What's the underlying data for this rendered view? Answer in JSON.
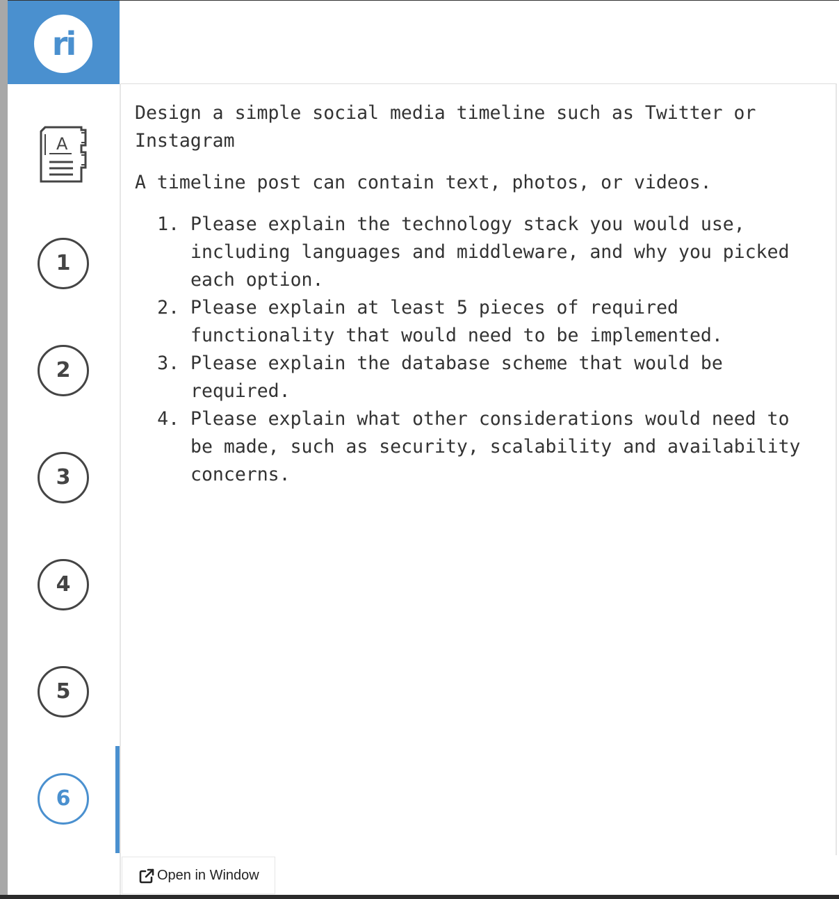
{
  "app": {
    "logo_text": "ri",
    "brand_color": "#4a90cf"
  },
  "sidebar": {
    "doc_icon": "document-instructions-icon",
    "doc_icon_letter": "A",
    "items": [
      {
        "label": "1"
      },
      {
        "label": "2"
      },
      {
        "label": "3"
      },
      {
        "label": "4"
      },
      {
        "label": "5"
      },
      {
        "label": "6",
        "active": true
      }
    ]
  },
  "content": {
    "title": "Design a simple social media timeline such as Twitter or Instagram",
    "intro": "A timeline post can contain text, photos, or videos.",
    "questions": [
      "Please explain the technology stack you would use, including languages and middleware, and why you picked each option.",
      "Please explain at least 5 pieces of required functionality that would need to be implemented.",
      "Please explain the database scheme that would be required.",
      "Please explain what other considerations would need to be made, such as security, scalability and availability concerns."
    ]
  },
  "footer": {
    "open_window_label": "Open in Window",
    "open_window_icon": "external-link-icon"
  }
}
